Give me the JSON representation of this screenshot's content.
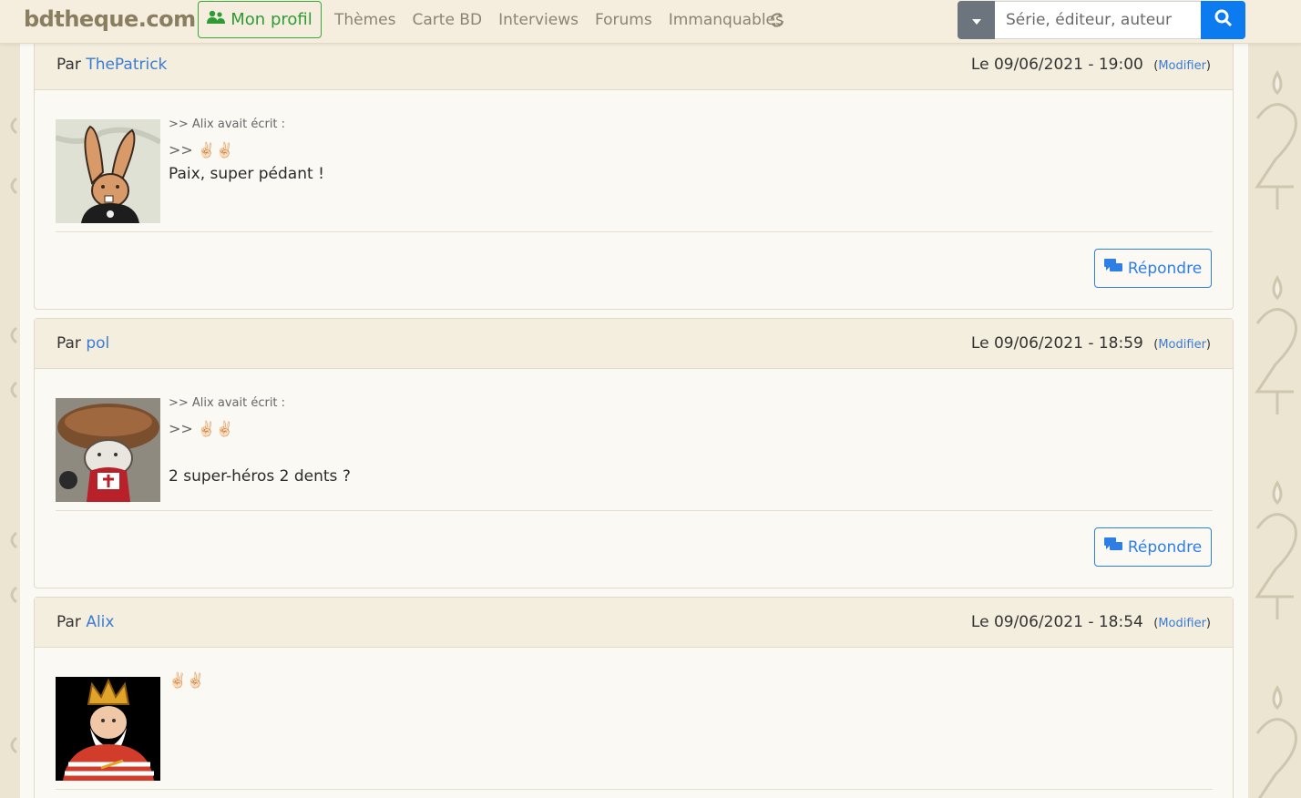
{
  "nav": {
    "brand": "bdtheque.com",
    "profile_label": "Mon profil",
    "links": [
      "Thèmes",
      "Carte BD",
      "Interviews",
      "Forums",
      "Immanquables"
    ],
    "search_placeholder": "Série, éditeur, auteur"
  },
  "posts": [
    {
      "by": "Par",
      "author": "ThePatrick",
      "date": "Le 09/06/2021 - 19:00",
      "modify": "Modifier",
      "quote_header": ">> Alix avait écrit :",
      "quote_text": ">> ✌🏻✌🏻",
      "message": "Paix, super pédant !",
      "reply": "Répondre"
    },
    {
      "by": "Par",
      "author": "pol",
      "date": "Le 09/06/2021 - 18:59",
      "modify": "Modifier",
      "quote_header": ">> Alix avait écrit :",
      "quote_text": ">> ✌🏻✌🏻",
      "message": "2 super-héros 2 dents ?",
      "reply": "Répondre"
    },
    {
      "by": "Par",
      "author": "Alix",
      "date": "Le 09/06/2021 - 18:54",
      "modify": "Modifier",
      "message": "✌🏻✌🏻"
    }
  ],
  "colors": {
    "accent": "#3a7bd5",
    "profile_green": "#2e9b35",
    "search_blue": "#0d7bf0",
    "header_bg": "#f4eede"
  },
  "icons": [
    "users-icon",
    "refresh-icon",
    "caret-down-icon",
    "search-icon",
    "chat-icon"
  ]
}
